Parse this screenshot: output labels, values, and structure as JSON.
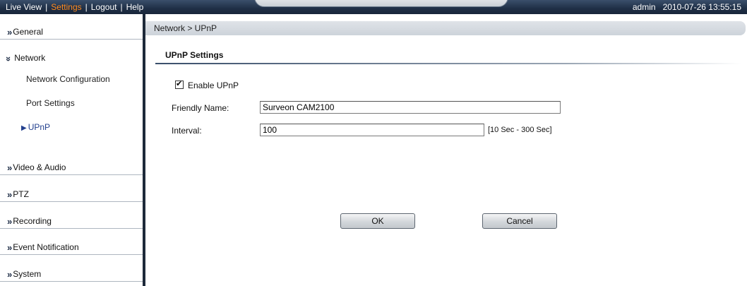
{
  "topbar": {
    "nav": [
      {
        "label": "Live View",
        "active": false
      },
      {
        "label": "Settings",
        "active": true
      },
      {
        "label": "Logout",
        "active": false
      },
      {
        "label": "Help",
        "active": false
      }
    ],
    "separator": "|",
    "user": "admin",
    "datetime": "2010-07-26 13:55:15"
  },
  "sidebar": {
    "chevron": "»",
    "sections": {
      "general": "General",
      "network": "Network",
      "video_audio": "Video & Audio",
      "ptz": "PTZ",
      "recording": "Recording",
      "event_notification": "Event Notification",
      "system": "System"
    },
    "network_items": {
      "config": "Network Configuration",
      "ports": "Port Settings",
      "upnp": "UPnP"
    }
  },
  "main": {
    "breadcrumb": "Network > UPnP",
    "title": "UPnP Settings",
    "enable_label": "Enable UPnP",
    "enable_checked": true,
    "friendly_name_label": "Friendly Name:",
    "friendly_name_value": "Surveon CAM2100",
    "interval_label": "Interval:",
    "interval_value": "100",
    "interval_hint": "[10 Sec - 300 Sec]",
    "ok_label": "OK",
    "cancel_label": "Cancel"
  },
  "colors": {
    "accent_active": "#ff8a1e",
    "topbar": "#1f2f46",
    "selected_item": "#23408e"
  }
}
